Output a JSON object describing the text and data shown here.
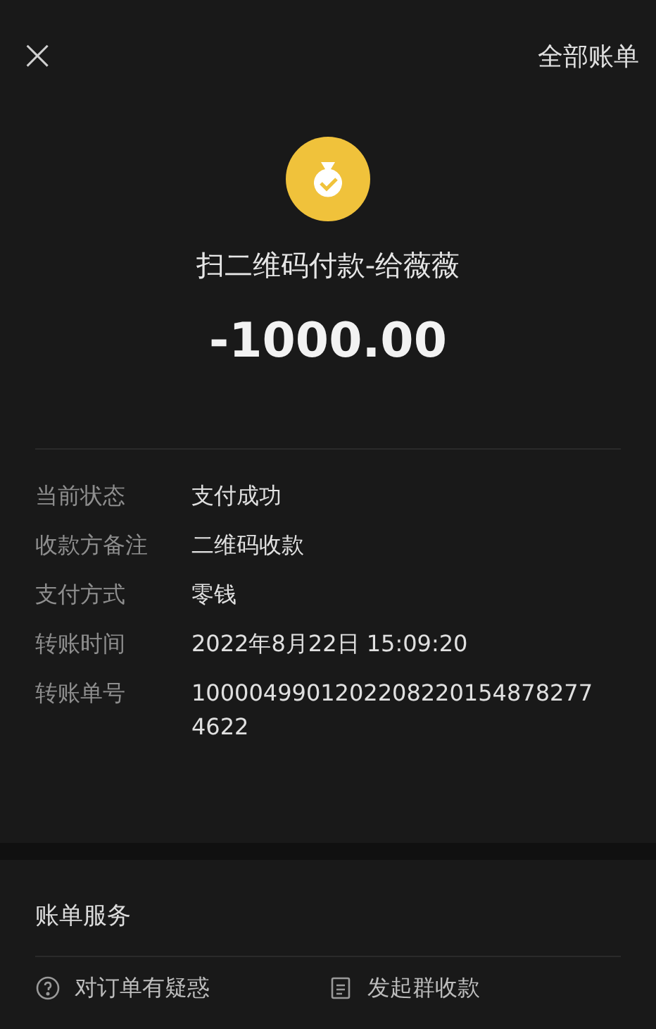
{
  "header": {
    "close_label": "×",
    "action": "全部账单"
  },
  "payment": {
    "title": "扫二维码付款-给薇薇",
    "amount": "-1000.00"
  },
  "details": [
    {
      "label": "当前状态",
      "value": "支付成功"
    },
    {
      "label": "收款方备注",
      "value": "二维码收款"
    },
    {
      "label": "支付方式",
      "value": "零钱"
    },
    {
      "label": "转账时间",
      "value": "2022年8月22日 15:09:20"
    },
    {
      "label": "转账单号",
      "value": "10000499012022082201548782774622"
    }
  ],
  "services": {
    "title": "账单服务",
    "items": [
      {
        "kind": "question",
        "label": "对订单有疑惑"
      },
      {
        "kind": "group",
        "label": "发起群收款"
      }
    ]
  }
}
